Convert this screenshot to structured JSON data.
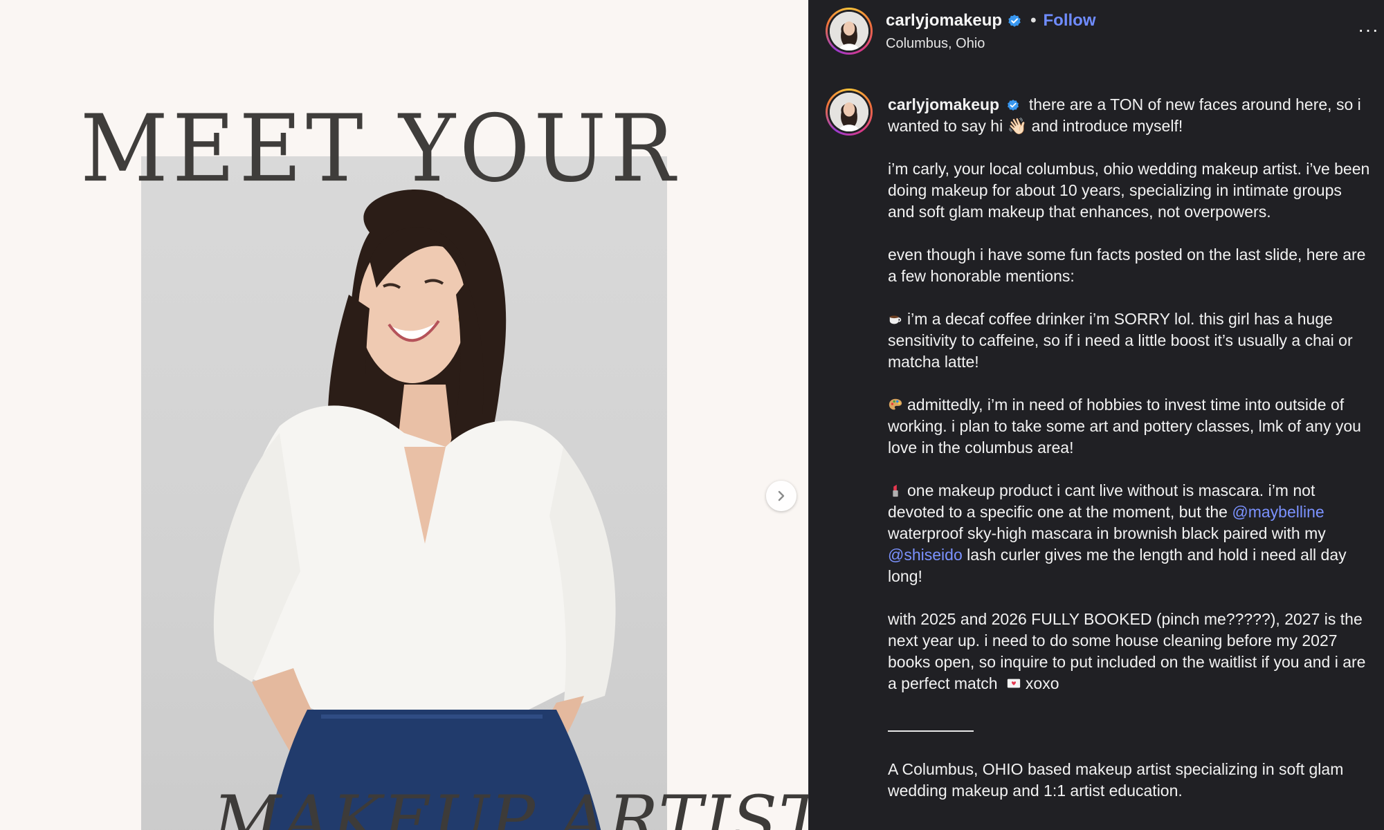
{
  "media": {
    "headline": "MEET YOUR",
    "subheadline": "MAKEUP ARTIST",
    "background_color": "#faf6f3"
  },
  "header": {
    "username": "carlyjomakeup",
    "separator": "•",
    "follow_label": "Follow",
    "location": "Columbus, Ohio",
    "more_label": "···"
  },
  "caption": {
    "username": "carlyjomakeup",
    "intro": "there are a TON of new faces around here, so i wanted to say hi 👋🏻 and introduce myself!",
    "para1": "i’m carly, your local columbus, ohio wedding makeup artist. i’ve been doing makeup for about 10 years, specializing in intimate groups and soft glam makeup that enhances, not overpowers.",
    "para2": "even though i have some fun facts posted on the last slide, here are a few honorable mentions:",
    "fact1": "i’m a decaf coffee drinker i’m SORRY lol. this girl has a huge sensitivity to caffeine, so if i need a little boost it’s usually a chai or matcha latte!",
    "fact2": "admittedly, i’m in need of hobbies to invest time into outside of working. i plan to take some art and pottery classes, lmk of any you love in the columbus area!",
    "fact3_a": "one makeup product i cant live without is mascara. i’m not devoted to a specific one at the moment, but the",
    "mention1": "@maybelline",
    "fact3_b": "waterproof sky-high mascara in brownish black paired with my",
    "mention2": "@shiseido",
    "fact3_c": "lash curler gives me the length and hold i need all day long!",
    "para3_a": "with 2025 and 2026 FULLY BOOKED (pinch me?????), 2027 is the next year up. i need to do some house cleaning before my 2027 books open, so inquire to put included on the waitlist if you and i are a perfect match",
    "para3_b": "xoxo",
    "bio": "A Columbus, OHIO based makeup artist specializing in soft glam wedding makeup and 1:1 artist education."
  },
  "icons": {
    "verified": "verified-badge-icon",
    "next": "chevron-right-icon",
    "coffee": "coffee-emoji",
    "palette": "palette-emoji",
    "lipstick": "lipstick-emoji",
    "letter": "love-letter-emoji"
  },
  "colors": {
    "panel_bg": "#202024",
    "link": "#6f8cff",
    "verified": "#3897f0"
  }
}
